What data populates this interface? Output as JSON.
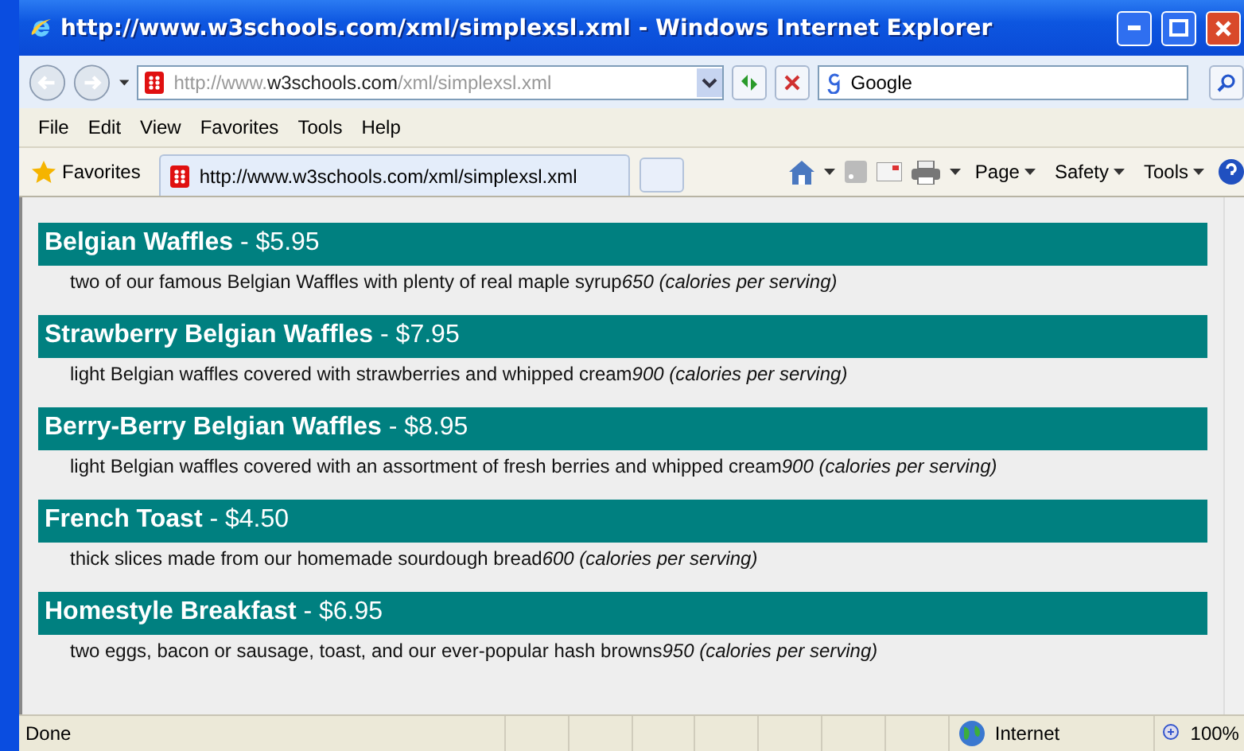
{
  "window": {
    "title": "http://www.w3schools.com/xml/simplexsl.xml - Windows Internet Explorer"
  },
  "address_bar": {
    "parts": [
      {
        "text": "http://www.",
        "strong": false
      },
      {
        "text": "w3schools.com",
        "strong": true
      },
      {
        "text": "/xml/simplexsl.xml",
        "strong": false
      }
    ]
  },
  "search": {
    "value": "Google"
  },
  "menu": [
    "File",
    "Edit",
    "View",
    "Favorites",
    "Tools",
    "Help"
  ],
  "favorites": {
    "label": "Favorites"
  },
  "tab": {
    "title": "http://www.w3schools.com/xml/simplexsl.xml",
    "selected": true
  },
  "command_bar": [
    "Page",
    "Safety",
    "Tools"
  ],
  "items": [
    {
      "heading": "**Belgian Waffles** - $5.95",
      "description": "two of our famous Belgian Waffles with plenty of real maple syrup",
      "calories": "650 (calories per serving)"
    },
    {
      "heading": "**Strawberry Belgian Waffles** - $7.95",
      "description": "light Belgian waffles covered with strawberries and whipped cream",
      "calories": "900 (calories per serving)"
    },
    {
      "heading": "**Berry-Berry Belgian Waffles** - $8.95",
      "description": "light Belgian waffles covered with an assortment of fresh berries and whipped cream",
      "calories": "900 (calories per serving)"
    },
    {
      "heading": "**French Toast** - $4.50",
      "description": "thick slices made from our homemade sourdough bread",
      "calories": "600 (calories per serving)"
    },
    {
      "heading": "**Homestyle Breakfast** - $6.95",
      "description": "two eggs, bacon or sausage, toast, and our ever-popular hash browns",
      "calories": "950 (calories per serving)"
    }
  ],
  "status_bar": {
    "status": "Done",
    "zone": "Internet",
    "zoom": "100%"
  }
}
